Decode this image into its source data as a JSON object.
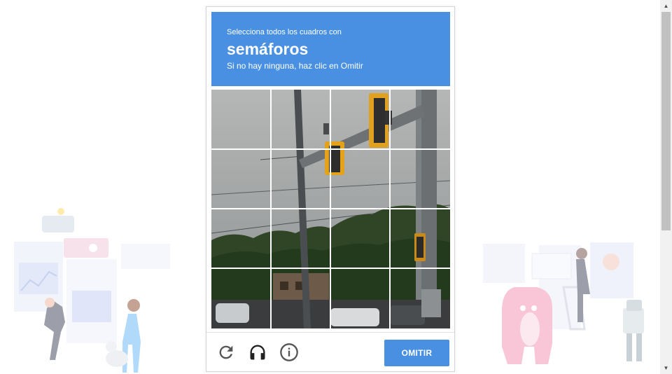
{
  "challenge": {
    "instruction_line1": "Selecciona todos los cuadros con",
    "target_object": "semáforos",
    "instruction_line3": "Si no hay ninguna, haz clic en Omitir"
  },
  "grid": {
    "rows": 4,
    "columns": 4
  },
  "footer": {
    "reload_icon": "reload-icon",
    "audio_icon": "headphones-icon",
    "info_icon": "info-icon",
    "skip_label": "OMITIR"
  },
  "colors": {
    "accent": "#4a90e2",
    "icon": "#555555"
  }
}
